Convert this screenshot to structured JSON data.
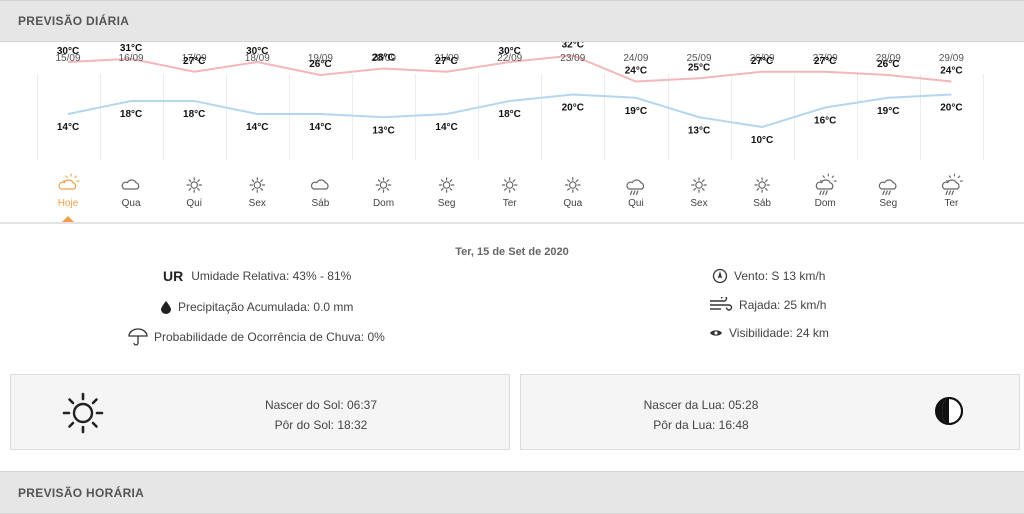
{
  "header": {
    "daily_title": "PREVISÃO DIÁRIA",
    "hourly_title": "PREVISÃO HORÁRIA"
  },
  "days": [
    {
      "date": "15/09",
      "max": "30°C",
      "min": "14°C",
      "maxv": 30,
      "minv": 14,
      "weekday": "Hoje",
      "icon": "cloud-sun-icon",
      "selected": true
    },
    {
      "date": "16/09",
      "max": "31°C",
      "min": "18°C",
      "maxv": 31,
      "minv": 18,
      "weekday": "Qua",
      "icon": "cloud-icon"
    },
    {
      "date": "17/09",
      "max": "27°C",
      "min": "18°C",
      "maxv": 27,
      "minv": 18,
      "weekday": "Qui",
      "icon": "sun-icon"
    },
    {
      "date": "18/09",
      "max": "30°C",
      "min": "14°C",
      "maxv": 30,
      "minv": 14,
      "weekday": "Sex",
      "icon": "sun-icon"
    },
    {
      "date": "19/09",
      "max": "26°C",
      "min": "14°C",
      "maxv": 26,
      "minv": 14,
      "weekday": "Sáb",
      "icon": "cloud-icon"
    },
    {
      "date": "20/09",
      "max": "28°C",
      "min": "13°C",
      "maxv": 28,
      "minv": 13,
      "weekday": "Dom",
      "icon": "sun-icon"
    },
    {
      "date": "21/09",
      "max": "27°C",
      "min": "14°C",
      "maxv": 27,
      "minv": 14,
      "weekday": "Seg",
      "icon": "sun-icon"
    },
    {
      "date": "22/09",
      "max": "30°C",
      "min": "18°C",
      "maxv": 30,
      "minv": 18,
      "weekday": "Ter",
      "icon": "sun-icon"
    },
    {
      "date": "23/09",
      "max": "32°C",
      "min": "20°C",
      "maxv": 32,
      "minv": 20,
      "weekday": "Qua",
      "icon": "sun-icon"
    },
    {
      "date": "24/09",
      "max": "24°C",
      "min": "19°C",
      "maxv": 24,
      "minv": 19,
      "weekday": "Qui",
      "icon": "cloud-rain-icon"
    },
    {
      "date": "25/09",
      "max": "25°C",
      "min": "13°C",
      "maxv": 25,
      "minv": 13,
      "weekday": "Sex",
      "icon": "sun-icon"
    },
    {
      "date": "26/09",
      "max": "27°C",
      "min": "10°C",
      "maxv": 27,
      "minv": 10,
      "weekday": "Sáb",
      "icon": "sun-icon"
    },
    {
      "date": "27/09",
      "max": "27°C",
      "min": "16°C",
      "maxv": 27,
      "minv": 16,
      "weekday": "Dom",
      "icon": "sun-cloud-rain-icon"
    },
    {
      "date": "28/09",
      "max": "26°C",
      "min": "19°C",
      "maxv": 26,
      "minv": 19,
      "weekday": "Seg",
      "icon": "cloud-rain-icon"
    },
    {
      "date": "29/09",
      "max": "24°C",
      "min": "20°C",
      "maxv": 24,
      "minv": 20,
      "weekday": "Ter",
      "icon": "sun-cloud-rain-icon"
    }
  ],
  "detail": {
    "date": "Ter, 15 de Set de 2020",
    "ur_tag": "UR",
    "humidity": "Umidade Relativa: 43% - 81%",
    "precip": "Precipitação Acumulada: 0.0 mm",
    "rain_prob": "Probabilidade de Ocorrência de Chuva: 0%",
    "wind": "Vento: S 13 km/h",
    "gust": "Rajada: 25 km/h",
    "visibility": "Visibilidade: 24 km"
  },
  "astro": {
    "sunrise": "Nascer do Sol: 06:37",
    "sunset": "Pôr do Sol: 18:32",
    "moonrise": "Nascer da Lua: 05:28",
    "moonset": "Pôr da Lua: 16:48"
  },
  "colors": {
    "max_line": "#f4b6b9",
    "min_line": "#b5d6ef",
    "accent": "#f0a04b",
    "icon": "#666666"
  }
}
